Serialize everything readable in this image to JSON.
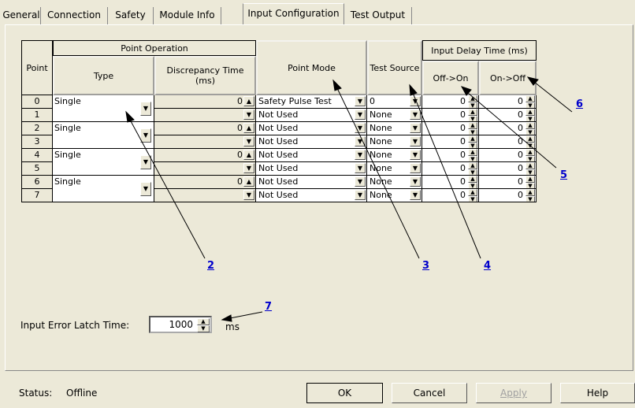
{
  "tabs": [
    "General",
    "Connection",
    "Safety",
    "Module Info",
    "Input Configuration",
    "Test Output"
  ],
  "headers": {
    "point": "Point",
    "point_operation": "Point Operation",
    "type": "Type",
    "discrepancy": "Discrepancy Time (ms)",
    "point_mode": "Point Mode",
    "test_source": "Test Source",
    "input_delay": "Input Delay Time (ms)",
    "off_on": "Off->On",
    "on_off": "On->Off"
  },
  "rows": [
    {
      "point": "0",
      "type": "Single",
      "disc": "0",
      "mode": "Safety Pulse Test",
      "source": "0",
      "offon": "0",
      "onoff": "0"
    },
    {
      "point": "1",
      "type": "",
      "disc": "",
      "mode": "Not Used",
      "source": "None",
      "offon": "0",
      "onoff": "0"
    },
    {
      "point": "2",
      "type": "Single",
      "disc": "0",
      "mode": "Not Used",
      "source": "None",
      "offon": "0",
      "onoff": "0"
    },
    {
      "point": "3",
      "type": "",
      "disc": "",
      "mode": "Not Used",
      "source": "None",
      "offon": "0",
      "onoff": "0"
    },
    {
      "point": "4",
      "type": "Single",
      "disc": "0",
      "mode": "Not Used",
      "source": "None",
      "offon": "0",
      "onoff": "0"
    },
    {
      "point": "5",
      "type": "",
      "disc": "",
      "mode": "Not Used",
      "source": "None",
      "offon": "0",
      "onoff": "0"
    },
    {
      "point": "6",
      "type": "Single",
      "disc": "0",
      "mode": "Not Used",
      "source": "None",
      "offon": "0",
      "onoff": "0"
    },
    {
      "point": "7",
      "type": "",
      "disc": "",
      "mode": "Not Used",
      "source": "None",
      "offon": "0",
      "onoff": "0"
    }
  ],
  "latch": {
    "label": "Input Error Latch Time:",
    "value": "1000",
    "unit": "ms"
  },
  "status": {
    "label": "Status:",
    "value": "Offline"
  },
  "buttons": {
    "ok": "OK",
    "cancel": "Cancel",
    "apply": "Apply",
    "help": "Help"
  },
  "callouts": {
    "c2": "2",
    "c3": "3",
    "c4": "4",
    "c5": "5",
    "c6": "6",
    "c7": "7"
  }
}
